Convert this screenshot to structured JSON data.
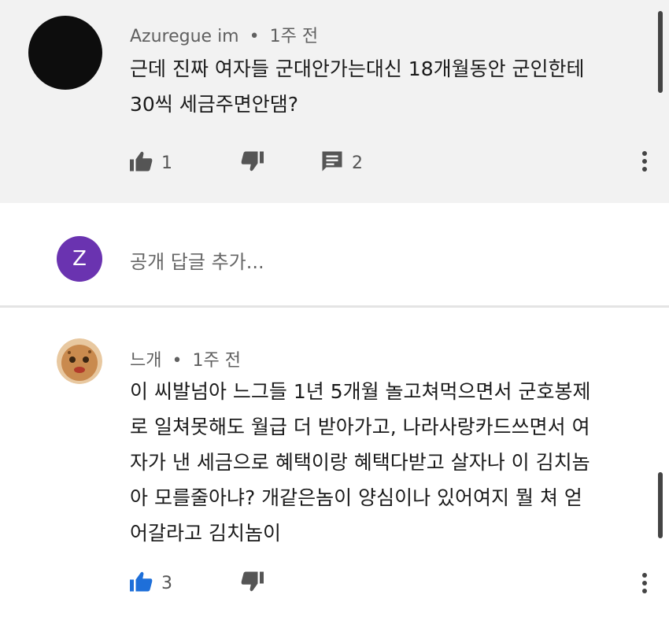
{
  "comment1": {
    "author": "Azuregue im",
    "separator": "•",
    "time": "1주 전",
    "lines": [
      "근데 진짜 여자들 군대안가는대신 18개월동안 군인한테",
      "30씩 세금주면안댐?"
    ],
    "likes": "1",
    "replies": "2"
  },
  "reply_box": {
    "avatar_letter": "Z",
    "placeholder": "공개 답글 추가..."
  },
  "comment2": {
    "author": "느개",
    "separator": "•",
    "time": "1주 전",
    "lines": [
      "이 씨발넘아 느그들 1년 5개월 놀고쳐먹으면서 군호봉제",
      "로 일쳐못해도 월급 더 받아가고, 나라사랑카드쓰면서 여",
      "자가 낸 세금으로 혜택이랑 혜택다받고 살자나 이 김치놈",
      "아 모를줄아냐? 개같은놈이 양심이나 있어여지 뭘 쳐 얻",
      "어갈라고 김치놈이"
    ],
    "likes": "3"
  },
  "colors": {
    "accent": "#1e6fd9",
    "avatar_z": "#6a33b0",
    "panel": "#f2f2f2"
  }
}
